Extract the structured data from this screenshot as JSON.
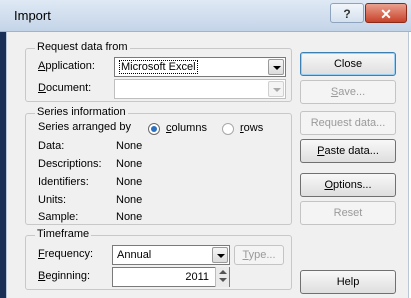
{
  "window": {
    "title": "Import",
    "help_glyph": "?",
    "close_glyph": "✕"
  },
  "request_group": {
    "legend": "Request data from",
    "application_label": "Application:",
    "application_value": "Microsoft Excel",
    "document_label": "Document:",
    "document_value": ""
  },
  "series_group": {
    "legend": "Series information",
    "arranged_label": "Series arranged by",
    "option_columns": "columns",
    "option_rows": "rows",
    "selected": "columns",
    "fields": [
      {
        "label": "Data:",
        "value": "None"
      },
      {
        "label": "Descriptions:",
        "value": "None"
      },
      {
        "label": "Identifiers:",
        "value": "None"
      },
      {
        "label": "Units:",
        "value": "None"
      },
      {
        "label": "Sample:",
        "value": "None"
      }
    ]
  },
  "timeframe_group": {
    "legend": "Timeframe",
    "frequency_label": "Frequency:",
    "frequency_value": "Annual",
    "type_button": "Type...",
    "beginning_label": "Beginning:",
    "beginning_value": "2011"
  },
  "buttons": {
    "close": "Close",
    "save": "Save...",
    "request_data": "Request data...",
    "paste_data": "Paste data...",
    "options": "Options...",
    "reset": "Reset",
    "help": "Help"
  }
}
